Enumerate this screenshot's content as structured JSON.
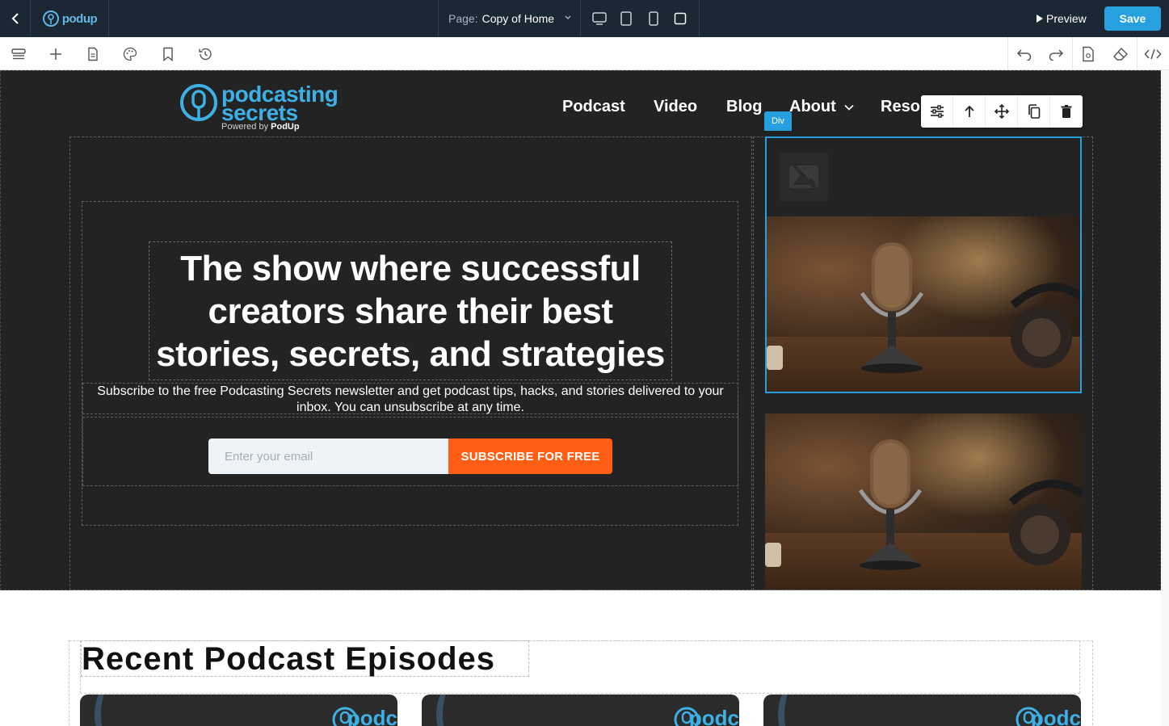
{
  "editor": {
    "app_logo": "podup",
    "page_label": "Page:",
    "page_name": "Copy of Home",
    "preview_label": "Preview",
    "save_label": "Save"
  },
  "site": {
    "logo_line1": "podcasting",
    "logo_line2": "secrets",
    "logo_powered": "Powered by",
    "logo_brand": "PodUp",
    "nav": {
      "podcast": "Podcast",
      "video": "Video",
      "blog": "Blog",
      "about": "About",
      "resources": "Reso"
    },
    "div_tag": "Div",
    "headline": "The show where successful creators share their best stories, secrets, and strategies",
    "subtext": "Subscribe to the free Podcasting Secrets newsletter and get podcast tips, hacks, and stories delivered to your inbox. You can unsubscribe at any time.",
    "email_placeholder": "Enter your email",
    "subscribe_label": "SUBSCRIBE FOR FREE",
    "recent_title": "Recent Podcast Episodes",
    "card_logo": "podc"
  },
  "colors": {
    "topbar": "#1b2733",
    "accent": "#27a0e0",
    "hero_bg": "#232323",
    "subscribe": "#ff5e14",
    "logo_blue": "#3db0e6"
  }
}
